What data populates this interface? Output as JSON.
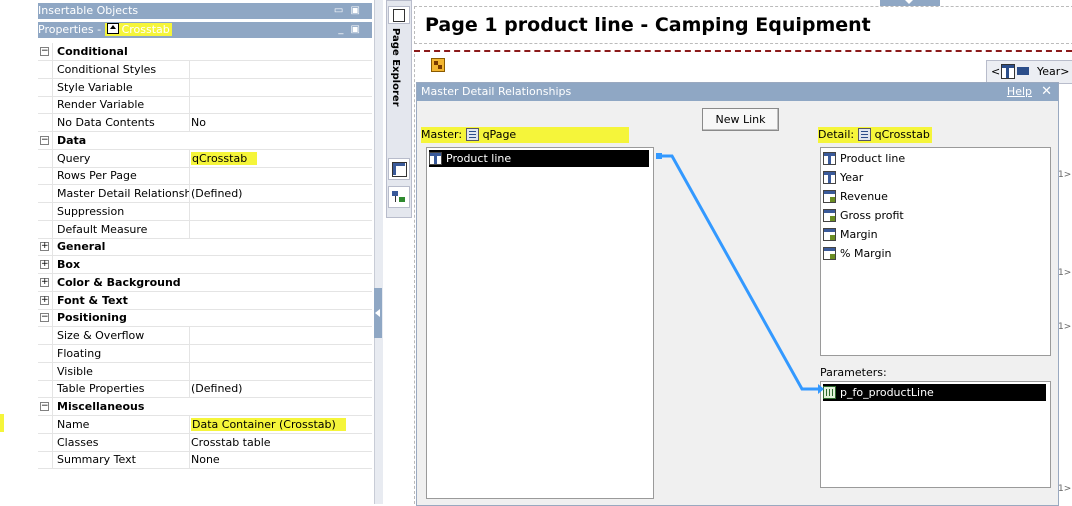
{
  "left_pane": {
    "insertable_title": "Insertable Objects",
    "properties_title_prefix": "Properties - ",
    "properties_title_object": "Crosstab",
    "title_buttons": "▭ ▣",
    "properties_buttons": "_ ▣"
  },
  "properties": [
    {
      "type": "cat",
      "toggle": "−",
      "name": "Conditional"
    },
    {
      "type": "prop",
      "name": "Conditional Styles",
      "value": ""
    },
    {
      "type": "prop",
      "name": "Style Variable",
      "value": ""
    },
    {
      "type": "prop",
      "name": "Render Variable",
      "value": ""
    },
    {
      "type": "prop",
      "name": "No Data Contents",
      "value": "No"
    },
    {
      "type": "cat",
      "toggle": "−",
      "name": "Data"
    },
    {
      "type": "prop",
      "name": "Query",
      "value": "qCrosstab",
      "highlight": true
    },
    {
      "type": "prop",
      "name": "Rows Per Page",
      "value": ""
    },
    {
      "type": "prop",
      "name": "Master Detail Relationships",
      "value": "(Defined)"
    },
    {
      "type": "prop",
      "name": "Suppression",
      "value": ""
    },
    {
      "type": "prop",
      "name": "Default Measure",
      "value": ""
    },
    {
      "type": "cat",
      "toggle": "+",
      "name": "General"
    },
    {
      "type": "cat",
      "toggle": "+",
      "name": "Box"
    },
    {
      "type": "cat",
      "toggle": "+",
      "name": "Color & Background"
    },
    {
      "type": "cat",
      "toggle": "+",
      "name": "Font & Text"
    },
    {
      "type": "cat",
      "toggle": "−",
      "name": "Positioning"
    },
    {
      "type": "prop",
      "name": "Size & Overflow",
      "value": ""
    },
    {
      "type": "prop",
      "name": "Floating",
      "value": ""
    },
    {
      "type": "prop",
      "name": "Visible",
      "value": ""
    },
    {
      "type": "prop",
      "name": "Table Properties",
      "value": "(Defined)"
    },
    {
      "type": "cat",
      "toggle": "−",
      "name": "Miscellaneous"
    },
    {
      "type": "prop",
      "name": "Name",
      "value": "Data Container (Crosstab)",
      "highlight": true
    },
    {
      "type": "prop",
      "name": "Classes",
      "value": "Crosstab table"
    },
    {
      "type": "prop",
      "name": "Summary Text",
      "value": "None"
    }
  ],
  "explorer": {
    "label": "Page Explorer"
  },
  "report": {
    "title": "Page 1 product line - Camping Equipment",
    "ruler_label": "Year>",
    "ruler_left": "<"
  },
  "dialog": {
    "title": "Master Detail Relationships",
    "help": "Help",
    "close": "✕",
    "new_link_label": "New Link",
    "master_label": "Master:",
    "master_query": "qPage",
    "detail_label": "Detail:",
    "detail_query": "qCrosstab",
    "parameters_label": "Parameters:",
    "master_items": [
      "Product line"
    ],
    "detail_items": [
      {
        "label": "Product line",
        "icon": "column-icon"
      },
      {
        "label": "Year",
        "icon": "column-icon"
      },
      {
        "label": "Revenue",
        "icon": "measure-icon"
      },
      {
        "label": "Gross profit",
        "icon": "measure-icon"
      },
      {
        "label": "Margin",
        "icon": "measure-icon"
      },
      {
        "label": "% Margin",
        "icon": "measure-icon"
      }
    ],
    "parameters": [
      "p_fo_productLine"
    ]
  },
  "colors": {
    "title_bar": "#8fa7c4",
    "highlight": "#f5f53a",
    "link_line": "#3399ff"
  }
}
